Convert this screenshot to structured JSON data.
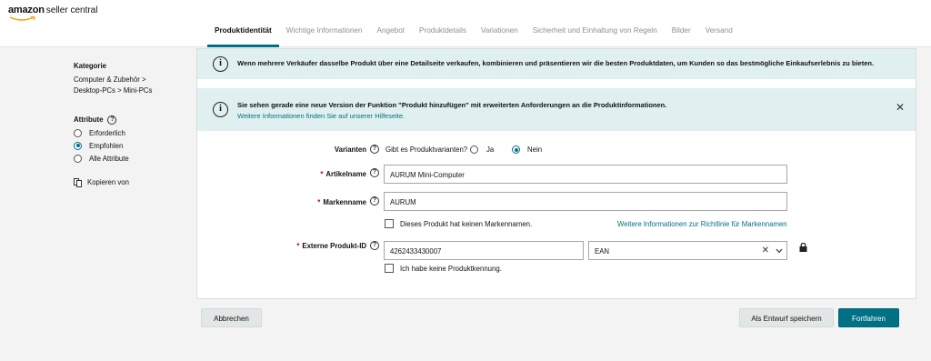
{
  "brand": {
    "logo_word": "amazon",
    "product": "seller central"
  },
  "tabs": [
    {
      "label": "Produktidentität",
      "active": true
    },
    {
      "label": "Wichtige Informationen"
    },
    {
      "label": "Angebot"
    },
    {
      "label": "Produktdetails"
    },
    {
      "label": "Variationen"
    },
    {
      "label": "Sicherheit und Einhaltung von Regeln"
    },
    {
      "label": "Bilder"
    },
    {
      "label": "Versand"
    }
  ],
  "sidebar": {
    "category_heading": "Kategorie",
    "category_line1": "Computer & Zubehör  >",
    "category_line2": "Desktop-PCs  >  Mini-PCs",
    "attributes_heading": "Attribute",
    "options": [
      {
        "label": "Erforderlich",
        "selected": false
      },
      {
        "label": "Empfohlen",
        "selected": true
      },
      {
        "label": "Alle Attribute",
        "selected": false
      }
    ],
    "copy_label": "Kopieren von"
  },
  "alerts": {
    "first": "Wenn mehrere Verkäufer dasselbe Produkt über eine Detailseite verkaufen, kombinieren und präsentieren wir die besten Produktdaten, um Kunden so das bestmögliche Einkaufserlebnis zu bieten.",
    "second": "Sie sehen gerade eine neue Version der Funktion \"Produkt hinzufügen\" mit erweiterten Anforderungen an die Produktinformationen.",
    "second_link": "Weitere Informationen finden Sie auf unserer Hilfeseite."
  },
  "form": {
    "variants_label": "Varianten",
    "variants_question": "Gibt es Produktvarianten?",
    "variants_yes": "Ja",
    "variants_no": "Nein",
    "variants_selected": "Nein",
    "item_name_label": "Artikelname",
    "item_name_value": "AURUM Mini-Computer",
    "brand_label": "Markenname",
    "brand_value": "AURUM",
    "no_brand_label": "Dieses Produkt hat keinen Markennamen.",
    "brand_policy_link": "Weitere Informationen zur Richtlinie für Markennamen",
    "external_id_label": "Externe Produkt-ID",
    "external_id_value": "4262433430007",
    "id_type_value": "EAN",
    "no_id_label": "Ich habe keine Produktkennung."
  },
  "footer": {
    "cancel": "Abbrechen",
    "save_draft": "Als Entwurf speichern",
    "continue": "Fortfahren"
  },
  "colors": {
    "accent": "#007185",
    "alert_bg": "#e0efef",
    "required": "#c40000"
  }
}
